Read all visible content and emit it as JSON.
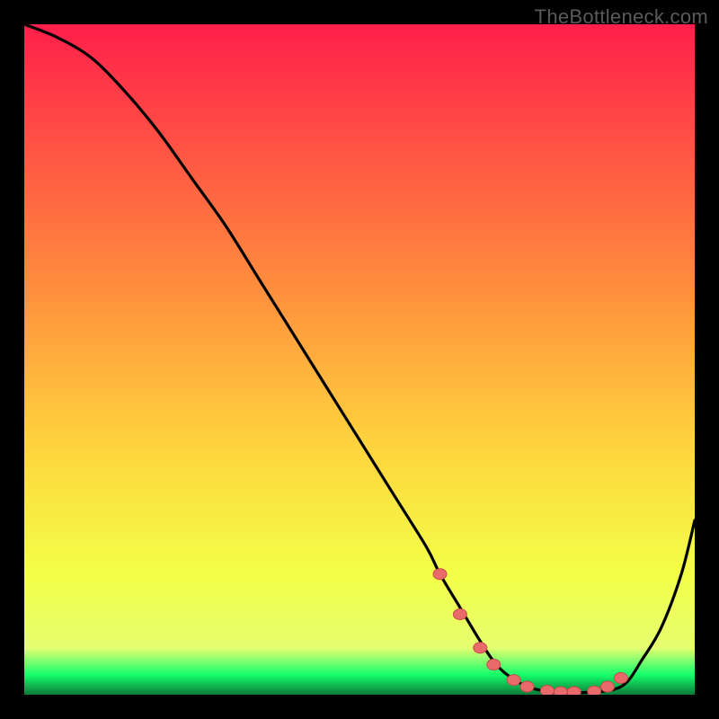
{
  "watermark": "TheBottleneck.com",
  "colors": {
    "top": "#ff1f4b",
    "mid_upper": "#ff7a3d",
    "mid": "#ffd23d",
    "mid_lower": "#f3ff47",
    "green": "#15ff6b",
    "black": "#000000",
    "curve": "#000000",
    "marker_fill": "#e86a6a",
    "marker_stroke": "#c84a4a"
  },
  "chart_data": {
    "type": "line",
    "title": "",
    "xlabel": "",
    "ylabel": "",
    "xlim": [
      0,
      100
    ],
    "ylim": [
      0,
      100
    ],
    "x": [
      0,
      5,
      10,
      15,
      20,
      25,
      30,
      35,
      40,
      45,
      50,
      55,
      60,
      62,
      65,
      68,
      70,
      72,
      75,
      78,
      80,
      82,
      85,
      88,
      90,
      92,
      95,
      98,
      100
    ],
    "values": [
      100,
      98,
      95,
      90,
      84,
      77,
      70,
      62,
      54,
      46,
      38,
      30,
      22,
      18,
      13,
      8,
      5,
      3,
      1.2,
      0.5,
      0.3,
      0.3,
      0.4,
      0.8,
      2,
      5,
      10,
      18,
      26
    ],
    "markers_x": [
      62,
      65,
      68,
      70,
      73,
      75,
      78,
      80,
      82,
      85,
      87,
      89
    ],
    "markers_y": [
      18,
      12,
      7,
      4.5,
      2.2,
      1.2,
      0.6,
      0.4,
      0.4,
      0.5,
      1.2,
      2.5
    ]
  }
}
